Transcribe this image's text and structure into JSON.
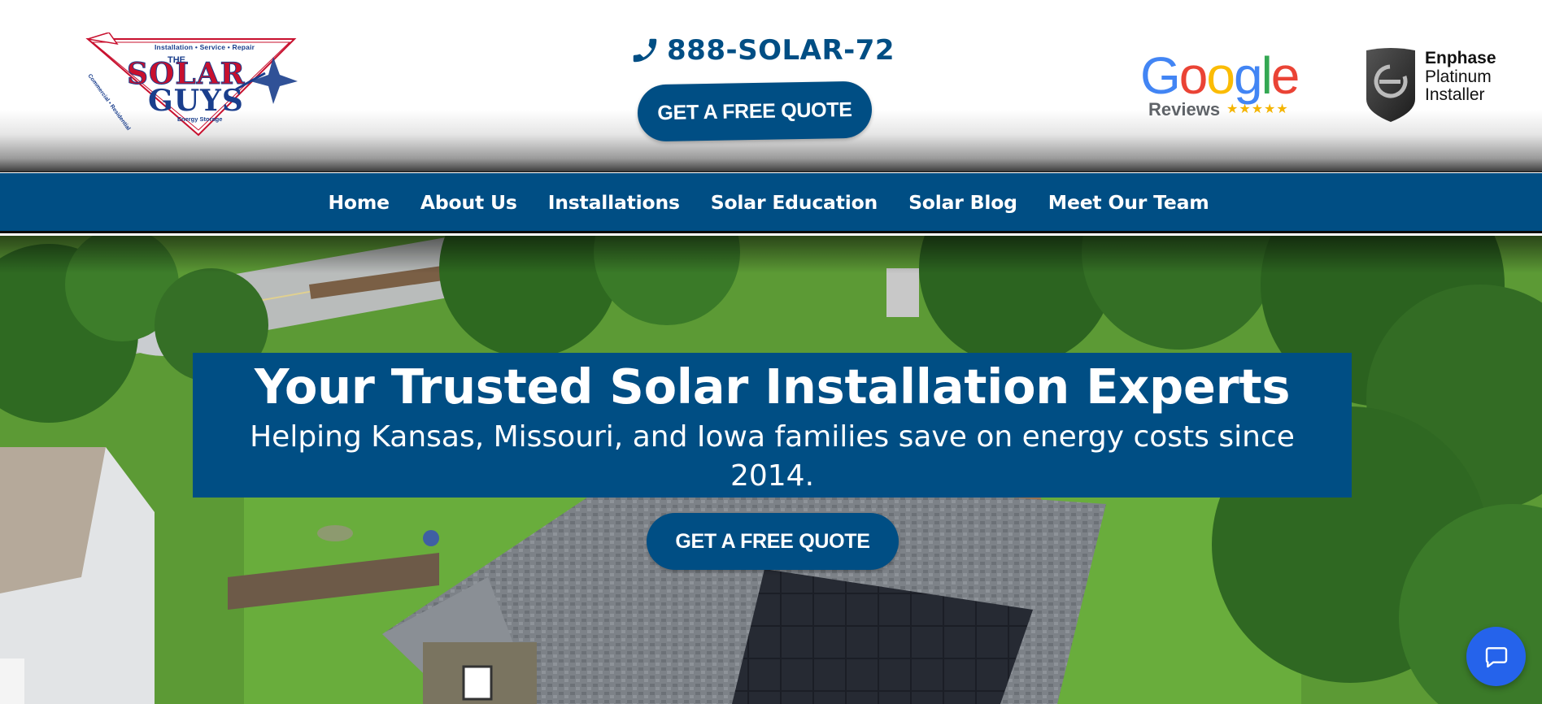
{
  "header": {
    "logo": {
      "top_text": "Installation • Service • Repair",
      "the": "THE",
      "solar": "SOLAR",
      "guys": "GUYS",
      "bottom_text": "Energy Storage",
      "side_text": "Commercial • Residential"
    },
    "phone": {
      "icon": "phone-icon",
      "number": "888-SOLAR-72"
    },
    "quote_button_label": "GET A FREE QUOTE",
    "google_badge": {
      "word": "Google",
      "reviews_label": "Reviews",
      "stars": "★★★★★"
    },
    "enphase_badge": {
      "line1": "Enphase",
      "line2": "Platinum",
      "line3": "Installer"
    }
  },
  "nav": {
    "items": [
      {
        "label": "Home"
      },
      {
        "label": "About Us"
      },
      {
        "label": "Installations"
      },
      {
        "label": "Solar Education"
      },
      {
        "label": "Solar Blog"
      },
      {
        "label": "Meet Our Team"
      }
    ]
  },
  "hero": {
    "title": "Your Trusted Solar Installation Experts",
    "subtitle": "Helping Kansas, Missouri, and Iowa families save on energy costs since 2014.",
    "cta_label": "GET A FREE QUOTE"
  },
  "chat": {
    "icon": "chat-bubble-icon"
  },
  "colors": {
    "brand_blue": "#004e84",
    "logo_red": "#c8102e",
    "chat_blue": "#2563eb",
    "google_blue": "#4285F4",
    "google_red": "#EA4335",
    "google_yellow": "#FBBC05",
    "google_green": "#34A853"
  }
}
